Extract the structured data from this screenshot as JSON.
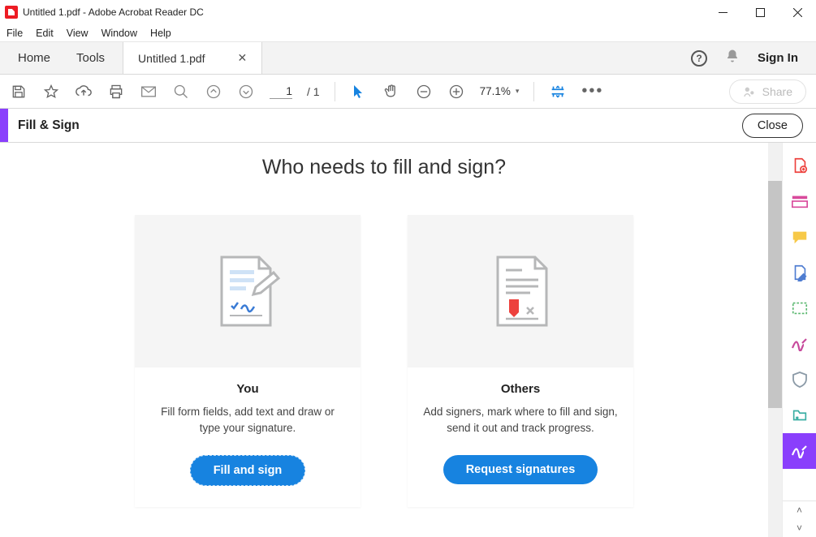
{
  "title_bar": {
    "text": "Untitled 1.pdf - Adobe Acrobat Reader DC"
  },
  "menu": {
    "items": [
      "File",
      "Edit",
      "View",
      "Window",
      "Help"
    ]
  },
  "tabs": {
    "home": "Home",
    "tools": "Tools",
    "doc_name": "Untitled 1.pdf",
    "sign_in": "Sign In"
  },
  "toolbar": {
    "page_current": "1",
    "page_total": "/ 1",
    "zoom": "77.1%",
    "share": "Share"
  },
  "subbar": {
    "title": "Fill & Sign",
    "close": "Close"
  },
  "main": {
    "heading": "Who needs to fill and sign?",
    "cards": [
      {
        "title": "You",
        "desc": "Fill form fields, add text and draw or type your signature.",
        "btn": "Fill and sign"
      },
      {
        "title": "Others",
        "desc": "Add signers, mark where to fill and sign, send it out and track progress.",
        "btn": "Request signatures"
      }
    ]
  }
}
